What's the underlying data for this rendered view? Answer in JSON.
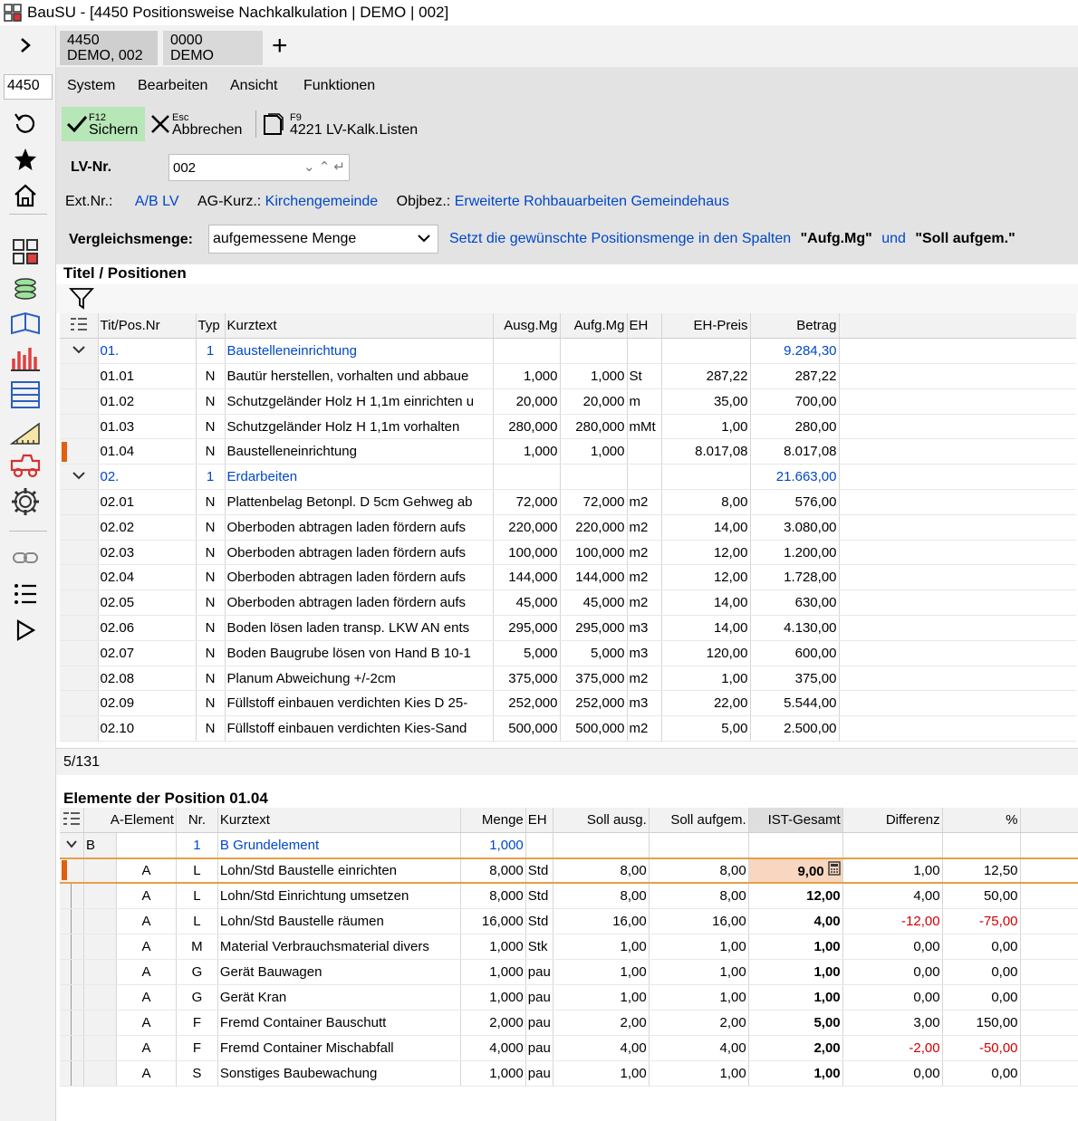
{
  "window": {
    "title": "BauSU - [4450 Positionsweise Nachkalkulation | DEMO | 002]"
  },
  "leftbar": {
    "project_input": "4450",
    "icons": [
      "chevron-right-icon",
      "refresh-icon",
      "star-icon",
      "home-icon",
      "modules-icon",
      "coins-icon",
      "book-icon",
      "chart-icon",
      "calculator-icon",
      "ruler-icon",
      "vehicle-icon",
      "gear-icon",
      "link-icon",
      "list-icon",
      "play-icon"
    ]
  },
  "tabs": [
    {
      "line1": "4450",
      "line2": "DEMO, 002"
    },
    {
      "line1": "0000",
      "line2": "DEMO"
    }
  ],
  "menu": [
    "System",
    "Bearbeiten",
    "Ansicht",
    "Funktionen"
  ],
  "toolbar": {
    "save": {
      "key": "F12",
      "label": "Sichern"
    },
    "cancel": {
      "key": "Esc",
      "label": "Abbrechen"
    },
    "lists": {
      "key": "F9",
      "label": "4221 LV-Kalk.Listen"
    }
  },
  "form": {
    "lv_label": "LV-Nr.",
    "lv_value": "002",
    "ext_label": "Ext.Nr.:",
    "ext_value": "A/B LV",
    "ag_label": "AG-Kurz.:",
    "ag_value": "Kirchengemeinde",
    "obj_label": "Objbez.:",
    "obj_value": "Erweiterte Rohbauarbeiten Gemeindehaus",
    "vergleich_label": "Vergleichsmenge:",
    "vergleich_value": "aufgemessene Menge",
    "hint_pre": "Setzt die gewünschte Positionsmenge in den Spalten",
    "hint_q1": "\"Aufg.Mg\"",
    "hint_mid": "und",
    "hint_q2": "\"Soll aufgem.\""
  },
  "positions": {
    "title": "Titel / Positionen",
    "headers": [
      "Tit/Pos.Nr",
      "Typ",
      "Kurztext",
      "Ausg.Mg",
      "Aufg.Mg",
      "EH",
      "EH-Preis",
      "Betrag"
    ],
    "rows": [
      {
        "nr": "01.",
        "typ": "1",
        "text": "Baustelleneinrichtung",
        "ausg": "",
        "aufg": "",
        "eh": "",
        "preis": "",
        "betrag": "9.284,30",
        "title": true
      },
      {
        "nr": "01.01",
        "typ": "N",
        "text": "Bautür herstellen, vorhalten und abbaue",
        "ausg": "1,000",
        "aufg": "1,000",
        "eh": "St",
        "preis": "287,22",
        "betrag": "287,22"
      },
      {
        "nr": "01.02",
        "typ": "N",
        "text": "Schutzgeländer Holz H 1,1m einrichten u",
        "ausg": "20,000",
        "aufg": "20,000",
        "eh": "m",
        "preis": "35,00",
        "betrag": "700,00"
      },
      {
        "nr": "01.03",
        "typ": "N",
        "text": "Schutzgeländer Holz H 1,1m vorhalten",
        "ausg": "280,000",
        "aufg": "280,000",
        "eh": "mMt",
        "preis": "1,00",
        "betrag": "280,00"
      },
      {
        "nr": "01.04",
        "typ": "N",
        "text": "Baustelleneinrichtung",
        "ausg": "1,000",
        "aufg": "1,000",
        "eh": "",
        "preis": "8.017,08",
        "betrag": "8.017,08",
        "marked": true
      },
      {
        "nr": "02.",
        "typ": "1",
        "text": "Erdarbeiten",
        "ausg": "",
        "aufg": "",
        "eh": "",
        "preis": "",
        "betrag": "21.663,00",
        "title": true
      },
      {
        "nr": "02.01",
        "typ": "N",
        "text": "Plattenbelag Betonpl. D 5cm Gehweg ab",
        "ausg": "72,000",
        "aufg": "72,000",
        "eh": "m2",
        "preis": "8,00",
        "betrag": "576,00"
      },
      {
        "nr": "02.02",
        "typ": "N",
        "text": "Oberboden abtragen laden fördern aufs",
        "ausg": "220,000",
        "aufg": "220,000",
        "eh": "m2",
        "preis": "14,00",
        "betrag": "3.080,00"
      },
      {
        "nr": "02.03",
        "typ": "N",
        "text": "Oberboden abtragen laden fördern aufs",
        "ausg": "100,000",
        "aufg": "100,000",
        "eh": "m2",
        "preis": "12,00",
        "betrag": "1.200,00"
      },
      {
        "nr": "02.04",
        "typ": "N",
        "text": "Oberboden abtragen laden fördern aufs",
        "ausg": "144,000",
        "aufg": "144,000",
        "eh": "m2",
        "preis": "12,00",
        "betrag": "1.728,00"
      },
      {
        "nr": "02.05",
        "typ": "N",
        "text": "Oberboden abtragen laden fördern aufs",
        "ausg": "45,000",
        "aufg": "45,000",
        "eh": "m2",
        "preis": "14,00",
        "betrag": "630,00"
      },
      {
        "nr": "02.06",
        "typ": "N",
        "text": "Boden lösen laden transp. LKW AN ents",
        "ausg": "295,000",
        "aufg": "295,000",
        "eh": "m3",
        "preis": "14,00",
        "betrag": "4.130,00"
      },
      {
        "nr": "02.07",
        "typ": "N",
        "text": "Boden Baugrube lösen von Hand B 10-1",
        "ausg": "5,000",
        "aufg": "5,000",
        "eh": "m3",
        "preis": "120,00",
        "betrag": "600,00"
      },
      {
        "nr": "02.08",
        "typ": "N",
        "text": "Planum Abweichung +/-2cm",
        "ausg": "375,000",
        "aufg": "375,000",
        "eh": "m2",
        "preis": "1,00",
        "betrag": "375,00"
      },
      {
        "nr": "02.09",
        "typ": "N",
        "text": "Füllstoff einbauen verdichten Kies D 25-",
        "ausg": "252,000",
        "aufg": "252,000",
        "eh": "m3",
        "preis": "22,00",
        "betrag": "5.544,00"
      },
      {
        "nr": "02.10",
        "typ": "N",
        "text": "Füllstoff einbauen verdichten Kies-Sand",
        "ausg": "500,000",
        "aufg": "500,000",
        "eh": "m2",
        "preis": "5,00",
        "betrag": "2.500,00"
      }
    ],
    "status": "5/131"
  },
  "elements": {
    "title": "Elemente der Position 01.04",
    "headers": [
      "A-Element",
      "Nr.",
      "Kurztext",
      "Menge",
      "EH",
      "Soll ausg.",
      "Soll aufgem.",
      "IST-Gesamt",
      "Differenz",
      "%"
    ],
    "group": {
      "ae": "B",
      "nr": "1",
      "text": "B Grundelement",
      "menge": "1,000"
    },
    "rows": [
      {
        "ae": "A",
        "nr": "L",
        "text": "Lohn/Std Baustelle einrichten",
        "menge": "8,000",
        "eh": "Std",
        "soll_ausg": "8,00",
        "soll_aufgem": "8,00",
        "ist": "9,00",
        "diff": "1,00",
        "pct": "12,50",
        "selected": true
      },
      {
        "ae": "A",
        "nr": "L",
        "text": "Lohn/Std Einrichtung umsetzen",
        "menge": "8,000",
        "eh": "Std",
        "soll_ausg": "8,00",
        "soll_aufgem": "8,00",
        "ist": "12,00",
        "diff": "4,00",
        "pct": "50,00"
      },
      {
        "ae": "A",
        "nr": "L",
        "text": "Lohn/Std Baustelle räumen",
        "menge": "16,000",
        "eh": "Std",
        "soll_ausg": "16,00",
        "soll_aufgem": "16,00",
        "ist": "4,00",
        "diff": "-12,00",
        "pct": "-75,00",
        "neg": true
      },
      {
        "ae": "A",
        "nr": "M",
        "text": "Material Verbrauchsmaterial divers",
        "menge": "1,000",
        "eh": "Stk",
        "soll_ausg": "1,00",
        "soll_aufgem": "1,00",
        "ist": "1,00",
        "diff": "0,00",
        "pct": "0,00"
      },
      {
        "ae": "A",
        "nr": "G",
        "text": "Gerät Bauwagen",
        "menge": "1,000",
        "eh": "pau",
        "soll_ausg": "1,00",
        "soll_aufgem": "1,00",
        "ist": "1,00",
        "diff": "0,00",
        "pct": "0,00"
      },
      {
        "ae": "A",
        "nr": "G",
        "text": "Gerät Kran",
        "menge": "1,000",
        "eh": "pau",
        "soll_ausg": "1,00",
        "soll_aufgem": "1,00",
        "ist": "1,00",
        "diff": "0,00",
        "pct": "0,00"
      },
      {
        "ae": "A",
        "nr": "F",
        "text": "Fremd Container Bauschutt",
        "menge": "2,000",
        "eh": "pau",
        "soll_ausg": "2,00",
        "soll_aufgem": "2,00",
        "ist": "5,00",
        "diff": "3,00",
        "pct": "150,00"
      },
      {
        "ae": "A",
        "nr": "F",
        "text": "Fremd Container Mischabfall",
        "menge": "4,000",
        "eh": "pau",
        "soll_ausg": "4,00",
        "soll_aufgem": "4,00",
        "ist": "2,00",
        "diff": "-2,00",
        "pct": "-50,00",
        "neg": true
      },
      {
        "ae": "A",
        "nr": "S",
        "text": "Sonstiges Baubewachung",
        "menge": "1,000",
        "eh": "pau",
        "soll_ausg": "1,00",
        "soll_aufgem": "1,00",
        "ist": "1,00",
        "diff": "0,00",
        "pct": "0,00"
      }
    ]
  },
  "colors": {
    "accent_green": "#b7e6b7",
    "link_blue": "#0047c9",
    "negative_red": "#d00000",
    "row_marker": "#e06010"
  }
}
